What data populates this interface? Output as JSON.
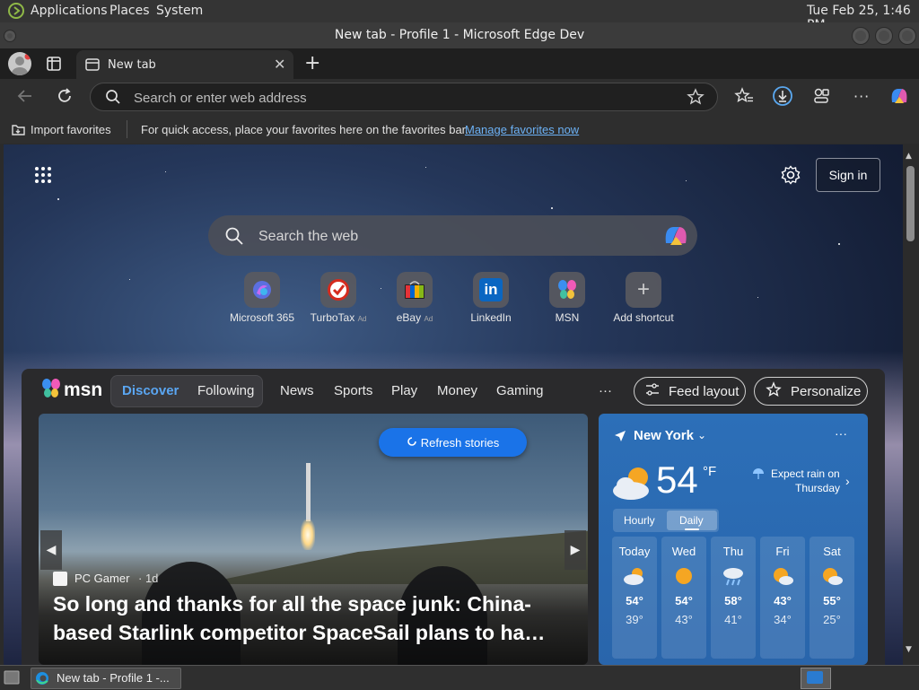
{
  "desktop": {
    "menu": [
      "Applications",
      "Places",
      "System"
    ],
    "clock": "Tue Feb 25,  1:46 PM"
  },
  "window": {
    "title": "New tab - Profile 1 - Microsoft Edge Dev"
  },
  "tabs": [
    {
      "label": "New tab"
    }
  ],
  "address_bar": {
    "placeholder": "Search or enter web address"
  },
  "favorites_bar": {
    "import_label": "Import favorites",
    "hint": "For quick access, place your favorites here on the favorites bar.",
    "manage_link": "Manage favorites now"
  },
  "newtab": {
    "sign_in": "Sign in",
    "search_placeholder": "Search the web",
    "shortcuts": [
      {
        "label": "Microsoft 365",
        "ad": ""
      },
      {
        "label": "TurboTax",
        "ad": "Ad"
      },
      {
        "label": "eBay",
        "ad": "Ad"
      },
      {
        "label": "LinkedIn",
        "ad": ""
      },
      {
        "label": "MSN",
        "ad": ""
      },
      {
        "label": "Add shortcut",
        "ad": ""
      }
    ]
  },
  "msn": {
    "logo": "msn",
    "tabs": [
      "Discover",
      "Following"
    ],
    "nav": [
      "News",
      "Sports",
      "Play",
      "Money",
      "Gaming"
    ],
    "more": "···",
    "feed_layout": "Feed layout",
    "personalize": "Personalize",
    "refresh": "Refresh stories",
    "story": {
      "source": "PC Gamer",
      "age": "· 1d",
      "headline": "So long and thanks for all the space junk: China-based Starlink competitor SpaceSail plans to ha…"
    }
  },
  "weather": {
    "location": "New York",
    "temp": "54",
    "unit": "°F",
    "alert_line1": "Expect rain on",
    "alert_line2": "Thursday",
    "modes": [
      "Hourly",
      "Daily"
    ],
    "days": [
      {
        "name": "Today",
        "icon": "partly-cloudy",
        "high": "54°",
        "low": "39°"
      },
      {
        "name": "Wed",
        "icon": "sunny",
        "high": "54°",
        "low": "43°"
      },
      {
        "name": "Thu",
        "icon": "rain",
        "high": "58°",
        "low": "41°"
      },
      {
        "name": "Fri",
        "icon": "partly-cloudy",
        "high": "43°",
        "low": "34°"
      },
      {
        "name": "Sat",
        "icon": "partly-cloudy",
        "high": "55°",
        "low": "25°"
      }
    ]
  },
  "taskbar": {
    "window_label": "New tab - Profile 1 -..."
  }
}
